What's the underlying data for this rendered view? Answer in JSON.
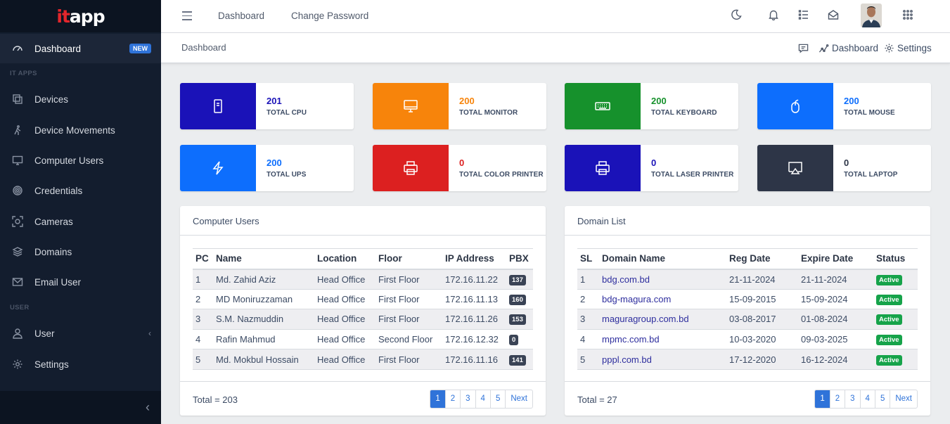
{
  "brand": {
    "it": "it",
    "app": "app"
  },
  "sidebar": {
    "items": [
      {
        "label": "Dashboard",
        "badge": "NEW"
      },
      {
        "label": "Devices"
      },
      {
        "label": "Device Movements"
      },
      {
        "label": "Computer Users"
      },
      {
        "label": "Credentials"
      },
      {
        "label": "Cameras"
      },
      {
        "label": "Domains"
      },
      {
        "label": "Email User"
      },
      {
        "label": "User"
      },
      {
        "label": "Settings"
      }
    ],
    "section_it_apps": "IT APPS",
    "section_user": "USER"
  },
  "header": {
    "links": [
      "Dashboard",
      "Change Password"
    ]
  },
  "subheader": {
    "breadcrumb": "Dashboard",
    "dashboard_link": "Dashboard",
    "settings_link": "Settings"
  },
  "stats": [
    {
      "value": "201",
      "label": "TOTAL CPU",
      "color": "#1a12b8",
      "icon": "cpu-icon"
    },
    {
      "value": "200",
      "label": "TOTAL MONITOR",
      "color": "#f7840b",
      "icon": "monitor-icon"
    },
    {
      "value": "200",
      "label": "TOTAL KEYBOARD",
      "color": "#16912c",
      "icon": "keyboard-icon"
    },
    {
      "value": "200",
      "label": "TOTAL MOUSE",
      "color": "#0d6efd",
      "icon": "mouse-icon"
    },
    {
      "value": "200",
      "label": "TOTAL UPS",
      "color": "#0d6efd",
      "icon": "bolt-icon"
    },
    {
      "value": "0",
      "label": "TOTAL COLOR PRINTER",
      "color": "#dc2020",
      "icon": "printer-icon"
    },
    {
      "value": "0",
      "label": "TOTAL LASER PRINTER",
      "color": "#1a12b8",
      "icon": "printer-icon"
    },
    {
      "value": "0",
      "label": "TOTAL LAPTOP",
      "color": "#2d3547",
      "icon": "laptop-icon"
    }
  ],
  "computer_users": {
    "title": "Computer Users",
    "columns": [
      "PC",
      "Name",
      "Location",
      "Floor",
      "IP Address",
      "PBX"
    ],
    "rows": [
      [
        "1",
        "Md. Zahid Aziz",
        "Head Office",
        "First Floor",
        "172.16.11.22",
        "137"
      ],
      [
        "2",
        "MD Moniruzzaman",
        "Head Office",
        "First Floor",
        "172.16.11.13",
        "160"
      ],
      [
        "3",
        "S.M. Nazmuddin",
        "Head Office",
        "First Floor",
        "172.16.11.26",
        "153"
      ],
      [
        "4",
        "Rafin Mahmud",
        "Head Office",
        "Second Floor",
        "172.16.12.32",
        "0"
      ],
      [
        "5",
        "Md. Mokbul Hossain",
        "Head Office",
        "First Floor",
        "172.16.11.16",
        "141"
      ]
    ],
    "total": "Total = 203",
    "pages": [
      "1",
      "2",
      "3",
      "4",
      "5",
      "Next"
    ]
  },
  "domain_list": {
    "title": "Domain List",
    "columns": [
      "SL",
      "Domain Name",
      "Reg Date",
      "Expire Date",
      "Status"
    ],
    "rows": [
      [
        "1",
        "bdg.com.bd",
        "21-11-2024",
        "21-11-2024",
        "Active"
      ],
      [
        "2",
        "bdg-magura.com",
        "15-09-2015",
        "15-09-2024",
        "Active"
      ],
      [
        "3",
        "maguragroup.com.bd",
        "03-08-2017",
        "01-08-2024",
        "Active"
      ],
      [
        "4",
        "mpmc.com.bd",
        "10-03-2020",
        "09-03-2025",
        "Active"
      ],
      [
        "5",
        "pppl.com.bd",
        "17-12-2020",
        "16-12-2024",
        "Active"
      ]
    ],
    "total": "Total = 27",
    "pages": [
      "1",
      "2",
      "3",
      "4",
      "5",
      "Next"
    ]
  }
}
